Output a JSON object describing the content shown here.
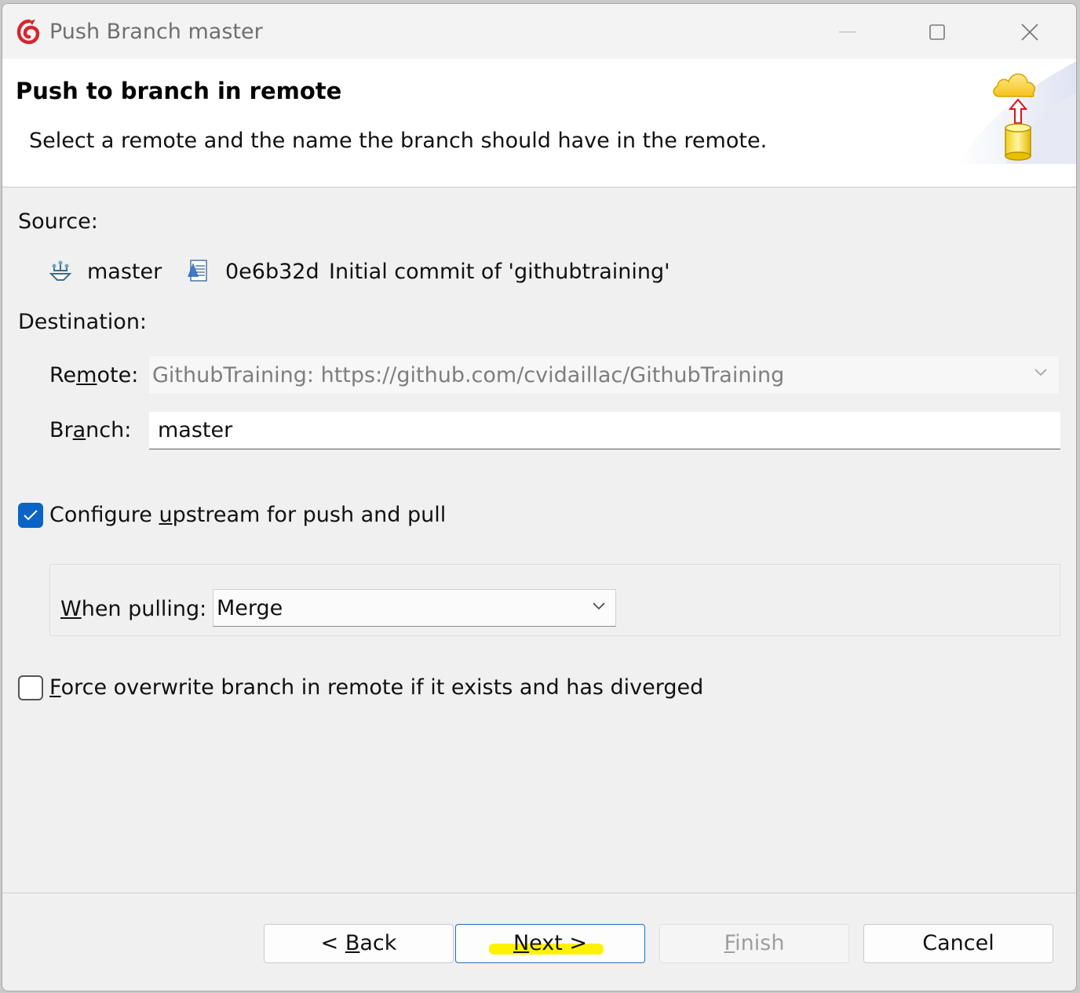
{
  "window": {
    "title": "Push Branch master"
  },
  "header": {
    "title": "Push to branch in remote",
    "description": "Select a remote and the name the branch should have in the remote."
  },
  "source": {
    "label": "Source:",
    "branch": "master",
    "commit_id": "0e6b32d",
    "commit_message": "Initial commit of 'githubtraining'"
  },
  "destination": {
    "label": "Destination:",
    "remote_label_pre": "Re",
    "remote_label_ul": "m",
    "remote_label_post": "ote:",
    "remote_value": "GithubTraining: https://github.com/cvidaillac/GithubTraining",
    "branch_label_pre": "Br",
    "branch_label_ul": "a",
    "branch_label_post": "nch:",
    "branch_value": "master"
  },
  "upstream": {
    "checked": true,
    "label_pre": "Configure ",
    "label_ul": "u",
    "label_post": "pstream for push and pull",
    "pull_label_ul": "W",
    "pull_label_post": "hen pulling:",
    "pull_value": "Merge"
  },
  "force": {
    "checked": false,
    "label_ul": "F",
    "label_post": "orce overwrite branch in remote if it exists and has diverged"
  },
  "buttons": {
    "back_pre": "< ",
    "back_ul": "B",
    "back_post": "ack",
    "next_ul": "N",
    "next_post": "ext >",
    "finish_ul": "F",
    "finish_post": "inish",
    "cancel": "Cancel"
  },
  "colors": {
    "accent": "#0a64c5",
    "highlight": "#fff200"
  },
  "icons": {
    "app": "eclipse-egit-icon",
    "branch": "branch-icon",
    "commit": "commit-icon",
    "banner": "push-cloud-banner-icon"
  }
}
